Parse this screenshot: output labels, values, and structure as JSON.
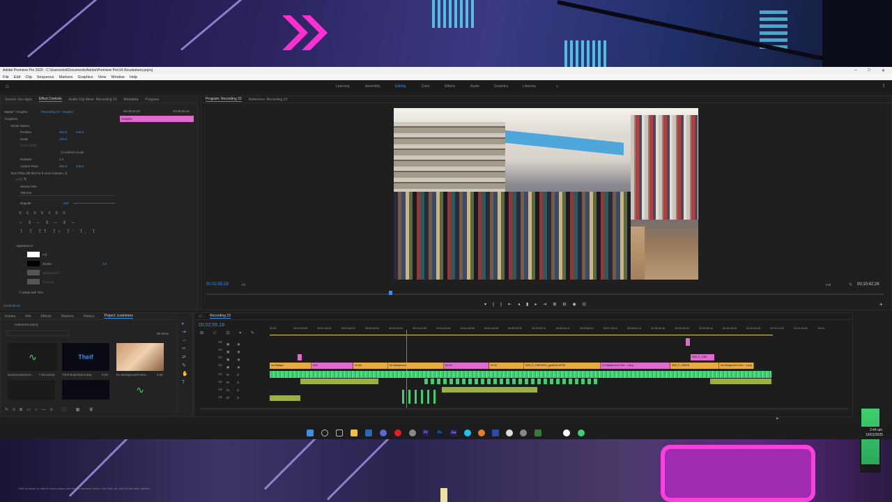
{
  "window": {
    "title": "Adobe Premiere Pro 2020 - C:\\Users\\elvit\\Documents\\Adobe\\Premiere Pro\\14.0\\customers.prproj"
  },
  "menu": [
    "File",
    "Edit",
    "Clip",
    "Sequence",
    "Markers",
    "Graphics",
    "View",
    "Window",
    "Help"
  ],
  "workspaces": [
    "Learning",
    "Assembly",
    "Editing",
    "Color",
    "Effects",
    "Audio",
    "Graphics",
    "Libraries"
  ],
  "active_workspace": "Editing",
  "source_tabs": [
    "Source: (no clips)",
    "Effect Controls",
    "Audio Clip Mixer: Recording 23",
    "Metadata",
    "Progress"
  ],
  "effect_controls": {
    "master": "Master * Graphic",
    "sequence": "Recording 23 * Graphic",
    "time_start": "00;08;52;16",
    "time_end": "00;08;56;16",
    "clip_label": "Graphic",
    "section": "Graphics",
    "vector_motion": "Vector Motion",
    "position_label": "Position",
    "position_x": "960.0",
    "position_y": "540.0",
    "scale_label": "Scale",
    "scale_value": "100.0",
    "scale_width_label": "Scale Width",
    "uniform_scale": "Uniform Scale",
    "rotation_label": "Rotation",
    "rotation_value": "0.0",
    "anchor_label": "Anchor Point",
    "anchor_x": "960.0",
    "anchor_y": "540.0",
    "text_layer": "Text (They did that for 5 more minutes :))",
    "source_text": "Source Text",
    "font": "Tahoma",
    "style": "Regular",
    "size": "100",
    "appearance": "Appearance",
    "fill": "Fill",
    "stroke": "Stroke",
    "stroke_value": "2.0",
    "background": "Background",
    "shadow": "Shadow",
    "mask_with_text": "Mask with Text",
    "current_time": "00;02;55;18"
  },
  "program": {
    "tab": "Program: Recording 23",
    "reference_tab": "Reference: Recording 23",
    "timecode": "00;02;55;18",
    "fit": "Fit",
    "quality": "Full",
    "duration": "00;10;42;26"
  },
  "project": {
    "tabs": [
      "braries",
      "Info",
      "Effects",
      "Markers",
      "History",
      "Project: customers"
    ],
    "file": "customers.prproj",
    "item_count": "85 Items",
    "items": [
      {
        "name": "lovesscustomers...",
        "duration": "7:25:21944"
      },
      {
        "name": "Theif Superstore.png",
        "duration": "4:29"
      },
      {
        "name": "No Background Here...",
        "duration": "4:29"
      }
    ],
    "thumb_text": "Theif"
  },
  "timeline": {
    "tab": "Recording 23",
    "timecode": "00;02;55;18",
    "ruler": [
      "00;00",
      "00;00;32;00",
      "00;01;04;02",
      "00;01;36;02",
      "00;02;08;04",
      "00;02;40;04",
      "00;03;12;06",
      "00;03;44;06",
      "00;04;16;08",
      "00;04;48;08",
      "00;05;20;10",
      "00;05;52;12",
      "00;06;24;12",
      "00;06;56;12",
      "00;07;28;14",
      "00;08;00;14",
      "00;08;32;16",
      "00;09;04;18",
      "00;09;36;18",
      "00;10;08;18",
      "00;10;40;18",
      "00;11;12;20",
      "00;11;44;20",
      "00;12;"
    ],
    "video_tracks": [
      "V4",
      "V3",
      "V2",
      "V1"
    ],
    "audio_tracks": [
      "A1",
      "A2",
      "A3",
      "A4"
    ],
    "clip_labels": [
      "No Backgro",
      "thief",
      "No Ba",
      "No Background",
      "No Ba",
      "No Bl",
      "SBD_P_235878021_gpathuhi-BKTM",
      "No Background Here - 3.png",
      "SBD_P_235878",
      "No Background Here - 3.png",
      "SBD_P_1188"
    ]
  },
  "status_bar": "Click to select, or click in empty space and drag to marquee select. Use Shift, Alt, and Ctrl for other options.",
  "clock": {
    "time": "2:44 am",
    "date": "19/01/2025"
  },
  "colors": {
    "accent": "#3d8fe0",
    "video_clip": "#e8a93e",
    "graphic_clip": "#e06ad0",
    "audio_clip": "#3ed070"
  }
}
